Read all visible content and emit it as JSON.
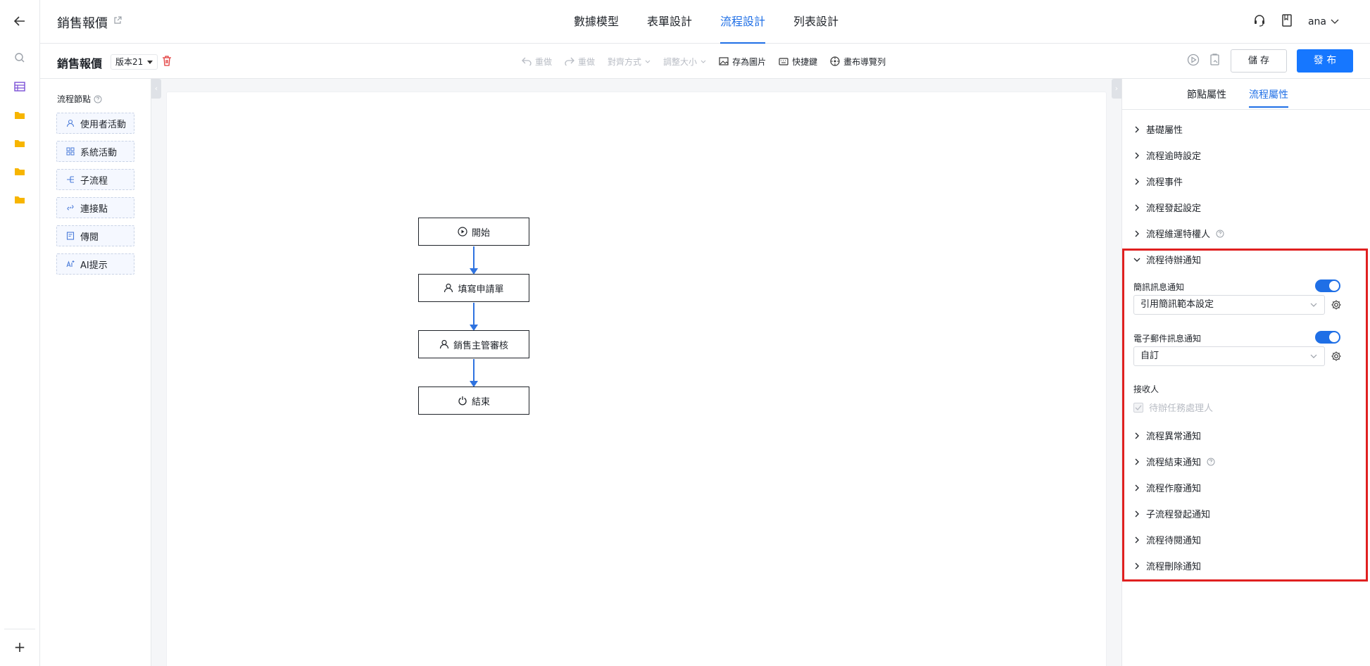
{
  "header": {
    "app_title": "銷售報價",
    "tabs": [
      {
        "label": "數據模型"
      },
      {
        "label": "表單設計"
      },
      {
        "label": "流程設計",
        "active": true
      },
      {
        "label": "列表設計"
      }
    ],
    "user_name": "ana"
  },
  "toolbar": {
    "process_name": "銷售報價",
    "version": "版本21",
    "tools": {
      "undo": "重做",
      "redo": "重做",
      "align": "對齊方式",
      "resize": "調整大小",
      "save_image": "存為圖片",
      "shortcuts": "快捷鍵",
      "nav_preview": "畫布導覽列"
    },
    "save_label": "儲 存",
    "publish_label": "發 布"
  },
  "palette": {
    "title": "流程節點",
    "items": [
      {
        "label": "使用者活動",
        "icon": "user-icon"
      },
      {
        "label": "系統活動",
        "icon": "grid-icon"
      },
      {
        "label": "子流程",
        "icon": "subflow-icon"
      },
      {
        "label": "連接點",
        "icon": "link-icon"
      },
      {
        "label": "傳閱",
        "icon": "document-icon"
      },
      {
        "label": "AI提示",
        "icon": "ai-icon"
      }
    ]
  },
  "flow": {
    "nodes": [
      {
        "label": "開始",
        "icon": "play-icon"
      },
      {
        "label": "填寫申請單",
        "icon": "user-icon"
      },
      {
        "label": "銷售主管審核",
        "icon": "user-icon"
      },
      {
        "label": "結束",
        "icon": "power-icon"
      }
    ]
  },
  "props": {
    "tabs": [
      {
        "label": "節點屬性"
      },
      {
        "label": "流程屬性",
        "active": true
      }
    ],
    "sections_before": [
      {
        "label": "基礎屬性"
      },
      {
        "label": "流程逾時設定"
      },
      {
        "label": "流程事件"
      },
      {
        "label": "流程發起設定"
      },
      {
        "label": "流程維運特權人",
        "help": true
      }
    ],
    "expanded": {
      "label": "流程待辦通知",
      "sms_label": "簡訊訊息通知",
      "sms_enabled": true,
      "sms_select": "引用簡訊範本設定",
      "email_label": "電子郵件訊息通知",
      "email_enabled": true,
      "email_select": "自訂",
      "recipient_label": "接收人",
      "recipient_option": "待辦任務處理人",
      "recipient_checked": true
    },
    "sections_after": [
      {
        "label": "流程異常通知"
      },
      {
        "label": "流程結束通知",
        "help": true
      },
      {
        "label": "流程作廢通知"
      },
      {
        "label": "子流程發起通知"
      },
      {
        "label": "流程待閱通知"
      },
      {
        "label": "流程刪除通知"
      }
    ]
  },
  "colors": {
    "accent": "#1f6fe6",
    "primary_button": "#1677ff",
    "highlight": "#e02020",
    "folder": "#f7b500"
  }
}
